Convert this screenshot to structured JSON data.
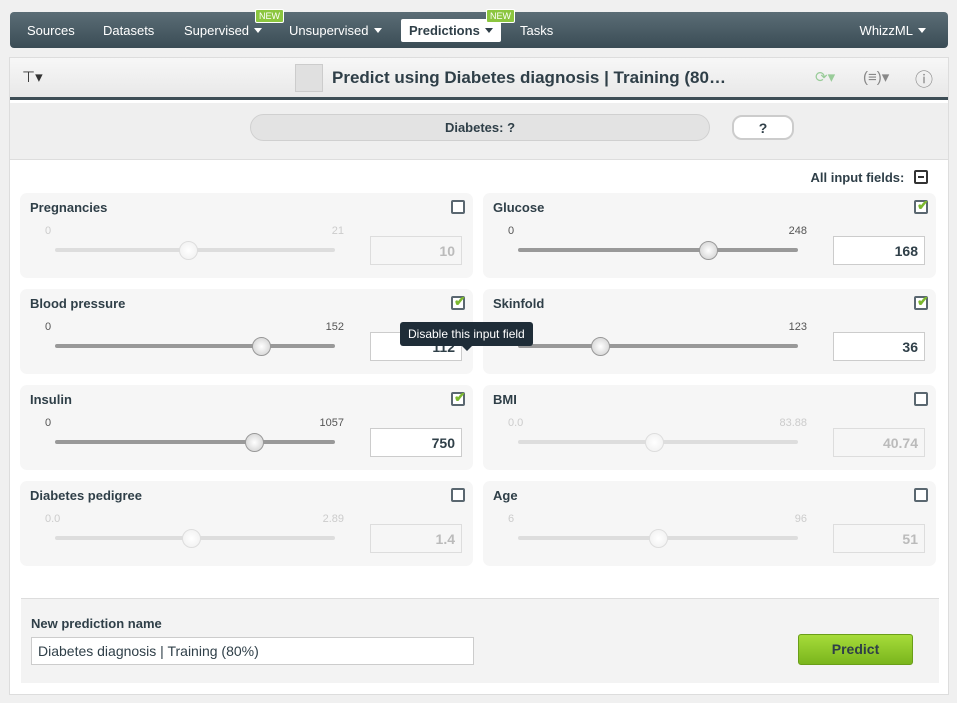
{
  "nav": {
    "items": [
      "Sources",
      "Datasets",
      "Supervised",
      "Unsupervised",
      "Predictions",
      "Tasks"
    ],
    "right": "WhizzML",
    "new_badge": "NEW"
  },
  "toolbar": {
    "title": "Predict using Diabetes diagnosis | Training (80…"
  },
  "prediction": {
    "label": "Diabetes: ?",
    "value": "?"
  },
  "all_input_fields": "All input fields:",
  "tooltip": "Disable this input field",
  "fields": [
    {
      "label": "Pregnancies",
      "min": "0",
      "max": "21",
      "value": "10",
      "enabled": false
    },
    {
      "label": "Glucose",
      "min": "0",
      "max": "248",
      "value": "168",
      "enabled": true
    },
    {
      "label": "Blood pressure",
      "min": "0",
      "max": "152",
      "value": "112",
      "enabled": true
    },
    {
      "label": "Skinfold",
      "min": "0",
      "max": "123",
      "value": "36",
      "enabled": true
    },
    {
      "label": "Insulin",
      "min": "0",
      "max": "1057",
      "value": "750",
      "enabled": true
    },
    {
      "label": "BMI",
      "min": "0.0",
      "max": "83.88",
      "value": "40.74",
      "enabled": false
    },
    {
      "label": "Diabetes pedigree",
      "min": "0.0",
      "max": "2.89",
      "value": "1.4",
      "enabled": false
    },
    {
      "label": "Age",
      "min": "6",
      "max": "96",
      "value": "51",
      "enabled": false
    }
  ],
  "new_prediction": {
    "label": "New prediction name",
    "value": "Diabetes diagnosis | Training (80%)"
  },
  "predict_button": "Predict",
  "colors": {
    "nav": "#3a4c55",
    "accent": "#8cc63f"
  }
}
